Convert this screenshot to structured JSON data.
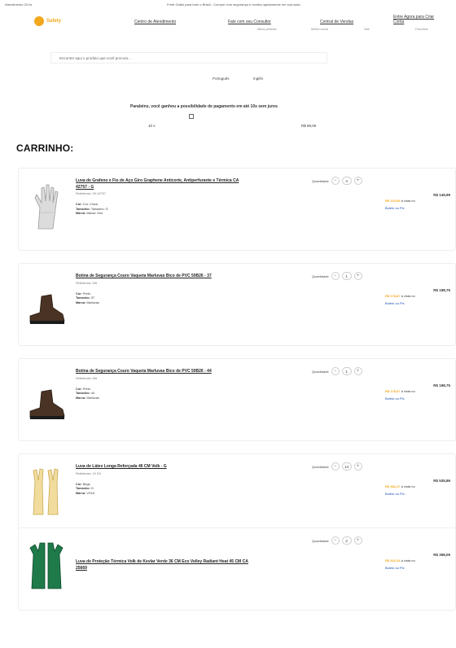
{
  "topbar": {
    "left": "Atendimento 24 hs",
    "center": "Frete Grátis para todo o Brasil - Compre com segurança e receba rapidamente em sua casa"
  },
  "brand": {
    "logo_text": "Safety"
  },
  "nav": [
    {
      "label": "Centro de Atendimento"
    },
    {
      "label": "Fale com seu Consultor"
    },
    {
      "label": "Central de Vendas"
    },
    {
      "label": "Entre Agora para Criar Conta"
    }
  ],
  "subnav": [
    {
      "label": "Meus pedidos"
    },
    {
      "label": "Minha conta"
    },
    {
      "label": "Sair"
    },
    {
      "label": "Favoritos"
    }
  ],
  "search": {
    "placeholder": "Encontre aqui o produto que você procura..."
  },
  "lang": {
    "left": "Português",
    "right": "Inglês"
  },
  "promo": {
    "text": "Parabéns, você ganhou a possibilidade de pagamento em até 10x sem juros",
    "val_left": "10 x",
    "val_right": "R$ 89,00"
  },
  "cart": {
    "title": "CARRINHO:"
  },
  "items": [
    {
      "name": "Luva de Grafeno e Fio de Aço Giro Graphene Anticorte, Antiperfurante e Térmica CA 42757 - G",
      "ref": "Referência: 2K-42757",
      "attr1": "Cor: Cinza",
      "attr2": "Tamanho: G",
      "attr3": "Marca: Giro",
      "qty": "4",
      "price_old": "R$ 149,99",
      "price_hl": "R$ 134,99",
      "price_after": "à vista no",
      "pix": "Boleto ou Pix",
      "qty_label": "Quantidade",
      "attr1_label": "Cor:",
      "attr2_label": "Tamanho:",
      "attr3_label": "Marca:"
    },
    {
      "name": "Botina de Segurança Couro Vaqueta Marluvas Bico de PVC 50B26 - 37",
      "ref": "Referência: MA",
      "attr1": "Preto",
      "attr2": "37",
      "attr3": "Marluvas",
      "qty": "1",
      "price_old": "R$ 198,75",
      "price_hl": "R$ 178,87",
      "price_after": "à vista no",
      "pix": "Boleto ou Pix",
      "qty_label": "Quantidade",
      "attr1_label": "Cor:",
      "attr2_label": "Tamanho:",
      "attr3_label": "Marca:"
    },
    {
      "name": "Botina de Segurança Couro Vaqueta Marluvas Bico de PVC 50B26 - 44",
      "ref": "Referência: MA",
      "attr1": "Preto",
      "attr2": "44",
      "attr3": "Marluvas",
      "qty": "1",
      "price_old": "R$ 198,75",
      "price_hl": "R$ 178,87",
      "price_after": "à vista no",
      "pix": "Boleto ou Pix",
      "qty_label": "Quantidade",
      "attr1_label": "Cor:",
      "attr2_label": "Tamanho:",
      "attr3_label": "Marca:"
    },
    {
      "name": "Luva de Látex Longa Reforçada 46 CM Volk - G",
      "ref": "Referência: 19 G9",
      "attr1": "Bege",
      "attr2": "G",
      "attr3": "VOLK",
      "qty": "14",
      "price_old": "R$ 535,86",
      "price_hl": "R$ 482,27",
      "price_after": "à vista no",
      "pix": "Boleto ou Pix",
      "qty_label": "Quantidade",
      "attr1_label": "Cor:",
      "attr2_label": "Tamanho:",
      "attr3_label": "Marca:"
    },
    {
      "name": "Luva de Proteção Térmica Volk de Kevlar Verde 36 CM Eco Volley Radiant Heat 45 CM CA 25669",
      "ref": "",
      "attr1": "",
      "attr2": "",
      "attr3": "",
      "qty": "2",
      "price_old": "R$ 358,05",
      "price_hl": "R$ 322,24",
      "price_after": "à vista no",
      "pix": "Boleto ou Pix",
      "qty_label": "Quantidade",
      "attr1_label": "",
      "attr2_label": "",
      "attr3_label": ""
    }
  ],
  "colors": {
    "accent": "#f2a81d",
    "link": "#1a4db3",
    "border": "#eeeeee"
  }
}
